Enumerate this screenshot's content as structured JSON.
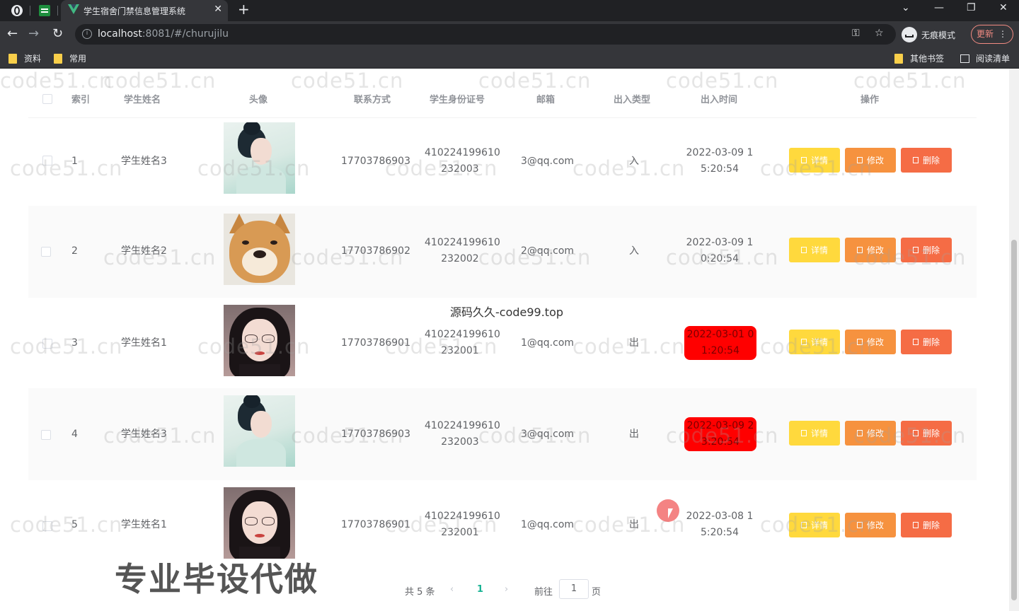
{
  "browser": {
    "tab_title": "学生宿舍门禁信息管理系统",
    "tab_close": "✕",
    "new_tab": "+",
    "url_host": "localhost",
    "url_rest": ":8081/#/churujilu",
    "incognito_label": "无痕模式",
    "update_label": "更新",
    "bookmarks": [
      "资料",
      "常用"
    ],
    "other_bookmarks": "其他书签",
    "reading_list": "阅读清单"
  },
  "table": {
    "headers": {
      "index": "索引",
      "name": "学生姓名",
      "avatar": "头像",
      "phone": "联系方式",
      "id_card": "学生身份证号",
      "email": "邮箱",
      "type": "出入类型",
      "time": "出入时间",
      "actions": "操作"
    },
    "rows": [
      {
        "index": "1",
        "name": "学生姓名3",
        "avatar": "woman-teal-avatar",
        "phone": "17703786903",
        "id_line1": "410224199610",
        "id_line2": "232003",
        "email": "3@qq.com",
        "type": "入",
        "time_line1": "2022-03-09 1",
        "time_line2": "5:20:54",
        "highlight": false
      },
      {
        "index": "2",
        "name": "学生姓名2",
        "avatar": "shiba-dog-avatar",
        "phone": "17703786902",
        "id_line1": "410224199610",
        "id_line2": "232002",
        "email": "2@qq.com",
        "type": "入",
        "time_line1": "2022-03-09 1",
        "time_line2": "0:20:54",
        "highlight": false
      },
      {
        "index": "3",
        "name": "学生姓名1",
        "avatar": "woman-glasses-avatar",
        "phone": "17703786901",
        "id_line1": "410224199610",
        "id_line2": "232001",
        "email": "1@qq.com",
        "type": "出",
        "time_line1": "2022-03-01 0",
        "time_line2": "1:20:54",
        "highlight": true
      },
      {
        "index": "4",
        "name": "学生姓名3",
        "avatar": "woman-teal-avatar",
        "phone": "17703786903",
        "id_line1": "410224199610",
        "id_line2": "232003",
        "email": "3@qq.com",
        "type": "出",
        "time_line1": "2022-03-09 2",
        "time_line2": "3:20:54",
        "highlight": true
      },
      {
        "index": "5",
        "name": "学生姓名1",
        "avatar": "woman-glasses-avatar",
        "phone": "17703786901",
        "id_line1": "410224199610",
        "id_line2": "232001",
        "email": "1@qq.com",
        "type": "出",
        "time_line1": "2022-03-08 1",
        "time_line2": "5:20:54",
        "highlight": false
      }
    ],
    "actions": {
      "detail": "详情",
      "edit": "修改",
      "delete": "删除"
    }
  },
  "pagination": {
    "total": "共 5 条",
    "prev": "‹",
    "current_page": "1",
    "next": "›",
    "goto_label": "前往",
    "goto_value": "1",
    "page_suffix": "页"
  },
  "overlays": {
    "watermark": "code51.cn",
    "center_caption": "源码久久-code99.top",
    "promo": "专业毕设代做"
  },
  "colors": {
    "accent": "#19b394",
    "detail_button": "#ffd93d",
    "edit_button": "#f6923f",
    "delete_button": "#f56c45",
    "time_alert": "#ff0000"
  }
}
